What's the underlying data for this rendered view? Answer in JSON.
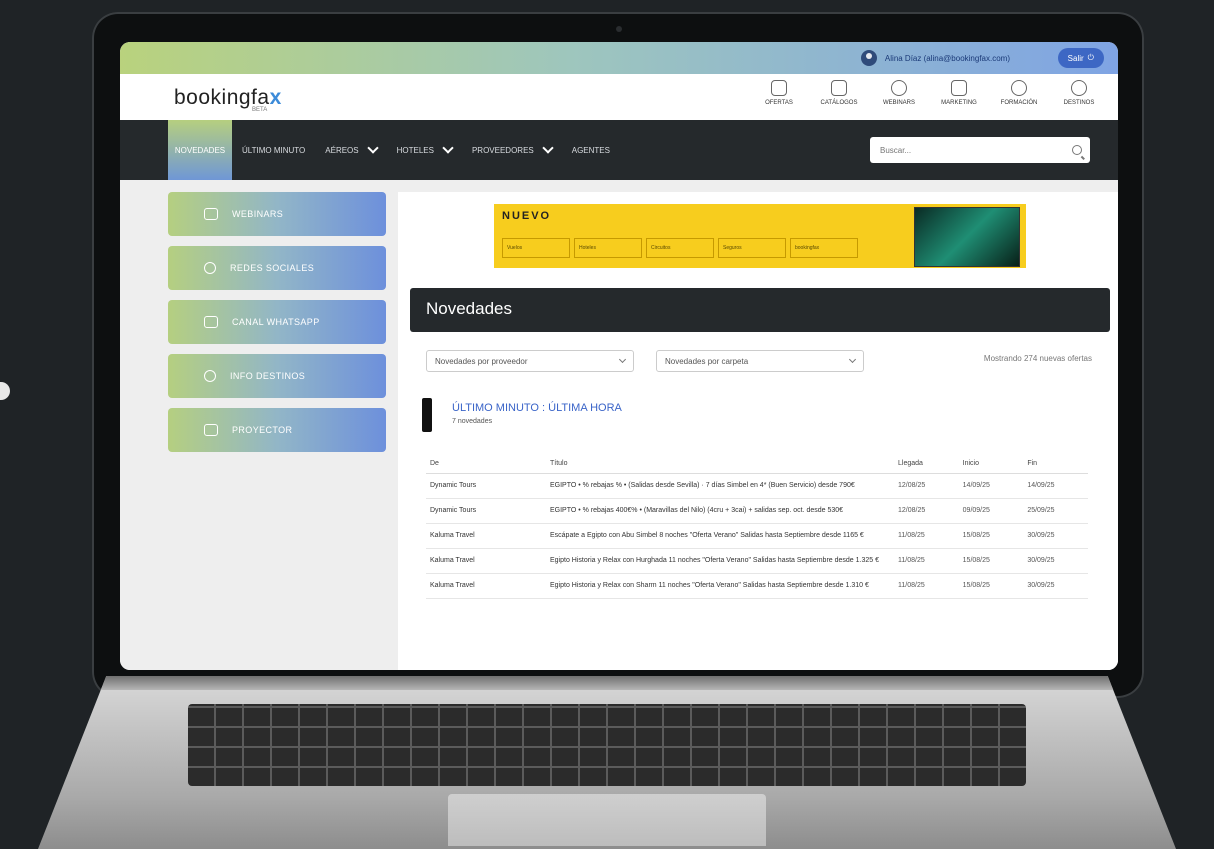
{
  "topbar": {
    "user_text": "Alina Díaz (alina@bookingfax.com)",
    "logout_label": "Salir"
  },
  "header": {
    "logo_main": "bookingfa",
    "logo_x": "x",
    "logo_sub": "BETA",
    "quick_links": [
      {
        "icon": "tag-icon",
        "label": "Ofertas"
      },
      {
        "icon": "book-icon",
        "label": "Catálogos"
      },
      {
        "icon": "headset-icon",
        "label": "Webinars"
      },
      {
        "icon": "briefcase-icon",
        "label": "Marketing"
      },
      {
        "icon": "graduation-icon",
        "label": "Formación"
      },
      {
        "icon": "pin-icon",
        "label": "Destinos"
      }
    ]
  },
  "nav": {
    "items": [
      {
        "label": "Novedades",
        "active": true,
        "dropdown": false
      },
      {
        "label": "Último minuto",
        "active": false,
        "dropdown": false
      },
      {
        "label": "Aéreos",
        "active": false,
        "dropdown": true
      },
      {
        "label": "Hoteles",
        "active": false,
        "dropdown": true
      },
      {
        "label": "Proveedores",
        "active": false,
        "dropdown": true
      },
      {
        "label": "Agentes",
        "active": false,
        "dropdown": false
      }
    ],
    "search_placeholder": "Buscar..."
  },
  "sidebar": {
    "items": [
      {
        "label": "Webinars",
        "icon": "monitor-icon"
      },
      {
        "label": "Redes sociales",
        "icon": "share-icon"
      },
      {
        "label": "Canal WhatsApp",
        "icon": "chat-icon"
      },
      {
        "label": "Info destinos",
        "icon": "globe-icon"
      },
      {
        "label": "Proyector",
        "icon": "projector-icon"
      }
    ]
  },
  "banner": {
    "title": "NUEVO",
    "items": [
      "Vuelos",
      "Hoteles",
      "Circuitos",
      "Seguros",
      "bookingfax"
    ]
  },
  "main": {
    "section_title": "Novedades",
    "filter_provider": "Novedades por proveedor",
    "filter_folder": "Novedades por carpeta",
    "filter_note": "Mostrando 274 nuevas ofertas",
    "subsection_title": "ÚLTIMO MINUTO : ÚLTIMA HORA",
    "subsection_count": "7 novedades",
    "table": {
      "headers": [
        "De",
        "Título",
        "Llegada",
        "Inicio",
        "Fin"
      ],
      "rows": [
        {
          "from": "Dynamic Tours",
          "title": "EGIPTO • % rebajas % • (Salidas desde Sevilla) · 7 días Simbel en 4* (Buen Servicio) desde 790€",
          "d1": "12/08/25",
          "d2": "14/09/25",
          "d3": "14/09/25"
        },
        {
          "from": "Dynamic Tours",
          "title": "EGIPTO • % rebajas 400€% • (Maravillas del Nilo) (4cru + 3cai) + salidas sep. oct. desde 530€",
          "d1": "12/08/25",
          "d2": "09/09/25",
          "d3": "25/09/25"
        },
        {
          "from": "Kaluma Travel",
          "title": "Escápate a Egipto con Abu Simbel 8 noches \"Oferta Verano\" Salidas hasta Septiembre desde 1165 €",
          "d1": "11/08/25",
          "d2": "15/08/25",
          "d3": "30/09/25"
        },
        {
          "from": "Kaluma Travel",
          "title": "Egipto Historia y Relax con Hurghada 11 noches \"Oferta Verano\" Salidas hasta Septiembre desde 1.325 €",
          "d1": "11/08/25",
          "d2": "15/08/25",
          "d3": "30/09/25"
        },
        {
          "from": "Kaluma Travel",
          "title": "Egipto Historia y Relax con Sharm 11 noches \"Oferta Verano\" Salidas hasta Septiembre desde 1.310 €",
          "d1": "11/08/25",
          "d2": "15/08/25",
          "d3": "30/09/25"
        }
      ]
    }
  }
}
